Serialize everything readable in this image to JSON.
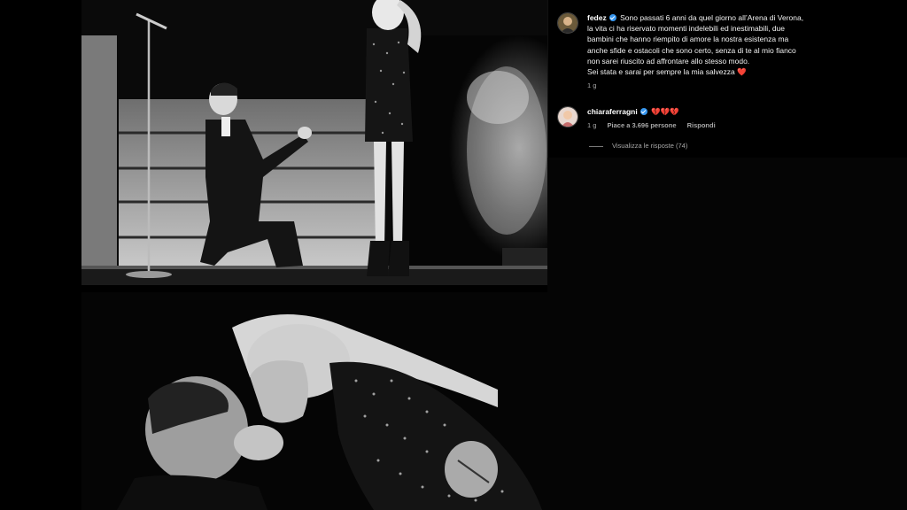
{
  "post": {
    "username": "fedez",
    "caption_lines": [
      "Sono passati 6 anni da quel giorno all’Arena di Verona,",
      "la vita ci ha riservato momenti indelebili ed inestimabili, due",
      "bambini che hanno riempito di amore la nostra esistenza ma",
      "anche sfide e ostacoli che sono certo, senza di te al mio fianco",
      "non sarei riuscito ad affrontare allo stesso modo.",
      "Sei stata e sarai per sempre la mia salvezza"
    ],
    "caption_emoji": "❤️",
    "time": "1 g"
  },
  "comment": {
    "username": "chiaraferragni",
    "emojis": "💔💔💔",
    "time": "1 g",
    "likes": "Piace a 3.696 persone",
    "reply_label": "Rispondi",
    "view_replies": "Visualizza le risposte (74)"
  },
  "colors": {
    "verified_badge": "#3797f0",
    "heart": "#ff3040",
    "meta_text": "#a8a8a8"
  }
}
